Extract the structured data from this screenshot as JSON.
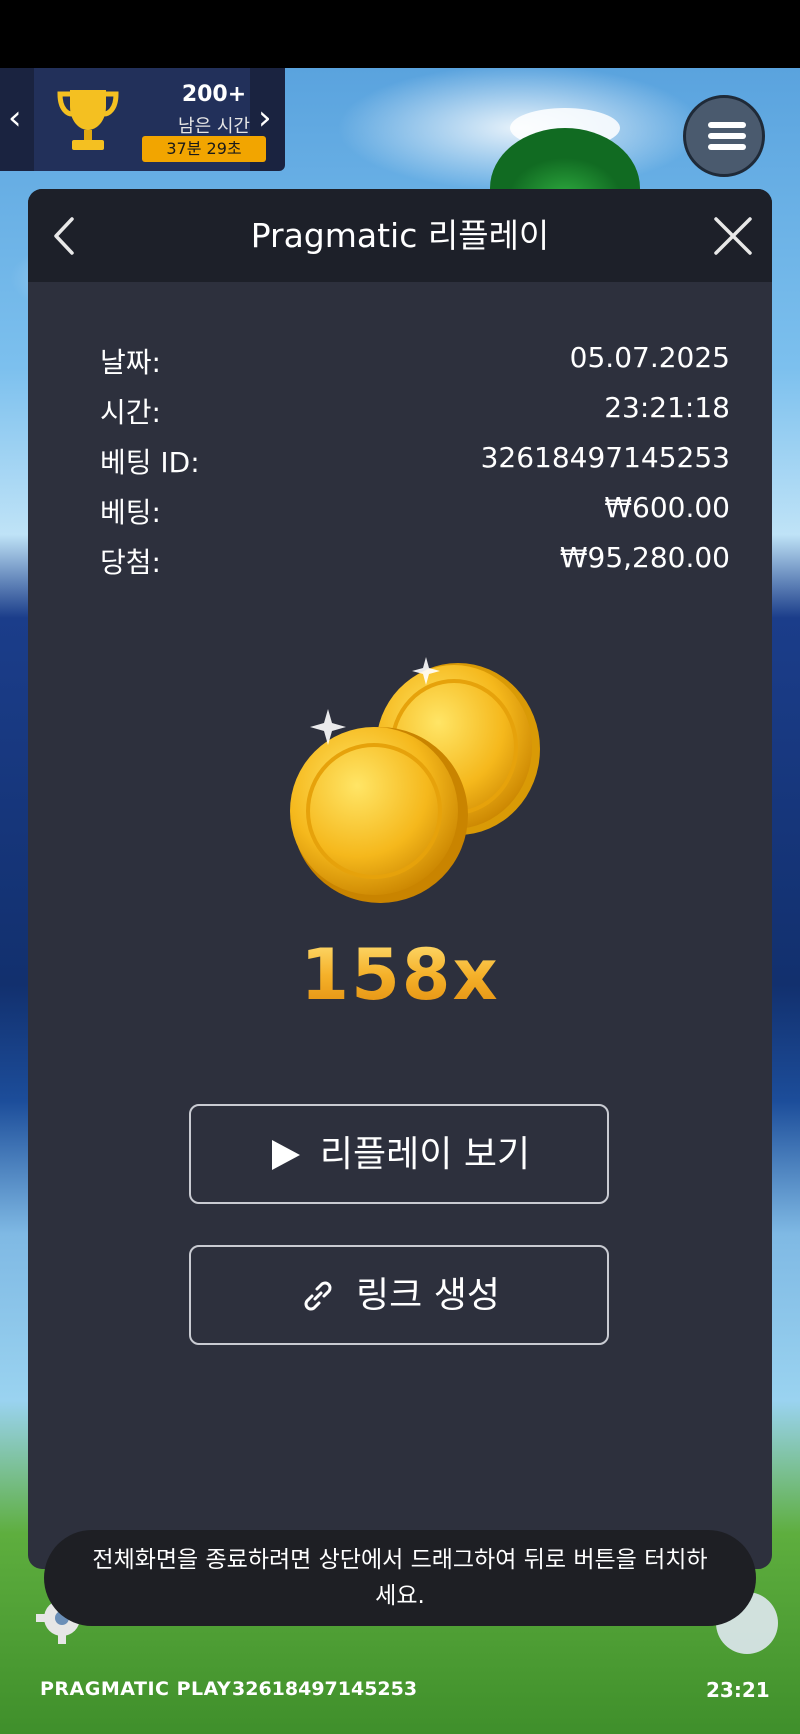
{
  "tournament": {
    "count": "200+",
    "label": "남은 시간",
    "timer": "37분 29초"
  },
  "replay": {
    "title": "Pragmatic 리플레이",
    "info": [
      {
        "key": "날짜:",
        "value": "05.07.2025"
      },
      {
        "key": "시간:",
        "value": "23:21:18"
      },
      {
        "key": "베팅 ID:",
        "value": "32618497145253"
      },
      {
        "key": "베팅:",
        "value": "₩600.00"
      },
      {
        "key": "당첨:",
        "value": "₩95,280.00"
      }
    ],
    "multiplier": "158x",
    "watch_button": "리플레이 보기",
    "link_button": "링크 생성"
  },
  "toast": {
    "message": "전체화면을 종료하려면 상단에서 드래그하여 뒤로 버튼을 터치하세요."
  },
  "footer": {
    "brand": "PRAGMATIC PLAY",
    "round_id": "32618497145253",
    "clock": "23:21"
  },
  "icons": {
    "trophy": "trophy-icon",
    "menu": "hamburger-menu-icon",
    "back": "chevron-left-icon",
    "close": "close-icon",
    "play": "play-icon",
    "link": "link-icon",
    "settings": "gear-icon",
    "info": "info-icon"
  },
  "colors": {
    "panel": "#2d303d",
    "header": "#1d2029",
    "accent": "#f2a500",
    "multiplier": "#f5a623"
  }
}
